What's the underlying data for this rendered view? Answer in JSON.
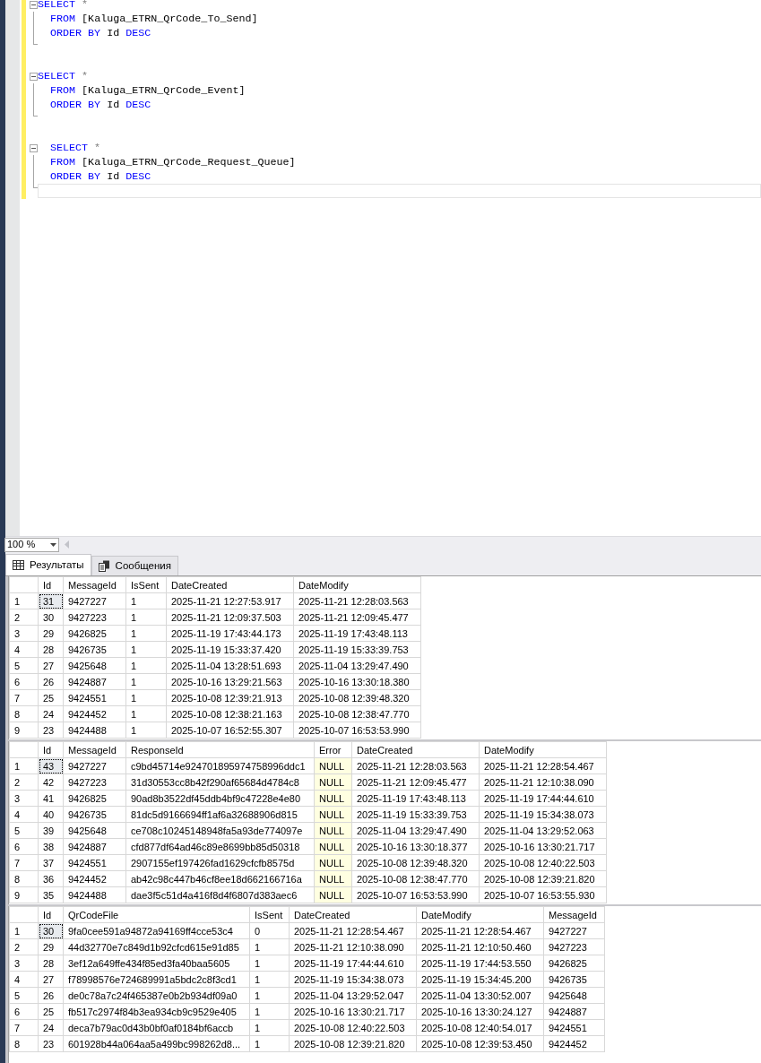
{
  "editor": {
    "blocks": [
      {
        "lines": [
          [
            {
              "kind": "keyword",
              "text": "SELECT"
            },
            {
              "kind": "operator",
              "text": " *"
            }
          ],
          [
            {
              "kind": "keyword",
              "text": "  FROM"
            },
            {
              "kind": "plain",
              "text": " [Kaluga_ETRN_QrCode_To_Send]"
            }
          ],
          [
            {
              "kind": "keyword",
              "text": "  ORDER BY"
            },
            {
              "kind": "plain",
              "text": " Id "
            },
            {
              "kind": "keyword",
              "text": "DESC"
            }
          ]
        ]
      },
      {
        "lines": [
          [
            {
              "kind": "keyword",
              "text": "SELECT"
            },
            {
              "kind": "operator",
              "text": " *"
            }
          ],
          [
            {
              "kind": "keyword",
              "text": "  FROM"
            },
            {
              "kind": "plain",
              "text": " [Kaluga_ETRN_QrCode_Event]"
            }
          ],
          [
            {
              "kind": "keyword",
              "text": "  ORDER BY"
            },
            {
              "kind": "plain",
              "text": " Id "
            },
            {
              "kind": "keyword",
              "text": "DESC"
            }
          ]
        ]
      },
      {
        "lines": [
          [
            {
              "kind": "keyword",
              "text": "  SELECT"
            },
            {
              "kind": "operator",
              "text": " *"
            }
          ],
          [
            {
              "kind": "keyword",
              "text": "  FROM"
            },
            {
              "kind": "plain",
              "text": " [Kaluga_ETRN_QrCode_Request_Queue]"
            }
          ],
          [
            {
              "kind": "keyword",
              "text": "  ORDER BY"
            },
            {
              "kind": "plain",
              "text": " Id "
            },
            {
              "kind": "keyword",
              "text": "DESC"
            }
          ]
        ]
      }
    ]
  },
  "zoom": "100 %",
  "tabs": [
    {
      "label": "Результаты",
      "kind": "grid",
      "selected": true
    },
    {
      "label": "Сообщения",
      "kind": "messages",
      "selected": false
    }
  ],
  "grids": [
    {
      "columns": [
        {
          "name": "Id",
          "kind": "text"
        },
        {
          "name": "MessageId",
          "kind": "text"
        },
        {
          "name": "IsSent",
          "kind": "text"
        },
        {
          "name": "DateCreated",
          "kind": "text"
        },
        {
          "name": "DateModify",
          "kind": "text"
        }
      ],
      "rows": [
        {
          "number": "1",
          "focused": true,
          "cells": [
            "31",
            "9427227",
            "1",
            "2025-11-21 12:27:53.917",
            "2025-11-21 12:28:03.563"
          ]
        },
        {
          "number": "2",
          "focused": false,
          "cells": [
            "30",
            "9427223",
            "1",
            "2025-11-21 12:09:37.503",
            "2025-11-21 12:09:45.477"
          ]
        },
        {
          "number": "3",
          "focused": false,
          "cells": [
            "29",
            "9426825",
            "1",
            "2025-11-19 17:43:44.173",
            "2025-11-19 17:43:48.113"
          ]
        },
        {
          "number": "4",
          "focused": false,
          "cells": [
            "28",
            "9426735",
            "1",
            "2025-11-19 15:33:37.420",
            "2025-11-19 15:33:39.753"
          ]
        },
        {
          "number": "5",
          "focused": false,
          "cells": [
            "27",
            "9425648",
            "1",
            "2025-11-04 13:28:51.693",
            "2025-11-04 13:29:47.490"
          ]
        },
        {
          "number": "6",
          "focused": false,
          "cells": [
            "26",
            "9424887",
            "1",
            "2025-10-16 13:29:21.563",
            "2025-10-16 13:30:18.380"
          ]
        },
        {
          "number": "7",
          "focused": false,
          "cells": [
            "25",
            "9424551",
            "1",
            "2025-10-08 12:39:21.913",
            "2025-10-08 12:39:48.320"
          ]
        },
        {
          "number": "8",
          "focused": false,
          "cells": [
            "24",
            "9424452",
            "1",
            "2025-10-08 12:38:21.163",
            "2025-10-08 12:38:47.770"
          ]
        },
        {
          "number": "9",
          "focused": false,
          "cells": [
            "23",
            "9424488",
            "1",
            "2025-10-07 16:52:55.307",
            "2025-10-07 16:53:53.990"
          ]
        }
      ]
    },
    {
      "columns": [
        {
          "name": "Id",
          "kind": "text"
        },
        {
          "name": "MessageId",
          "kind": "text"
        },
        {
          "name": "ResponseId",
          "kind": "text"
        },
        {
          "name": "Error",
          "kind": "null"
        },
        {
          "name": "DateCreated",
          "kind": "text"
        },
        {
          "name": "DateModify",
          "kind": "text"
        }
      ],
      "rows": [
        {
          "number": "1",
          "focused": true,
          "cells": [
            "43",
            "9427227",
            "c9bd45714e924701895974758996ddc1",
            "NULL",
            "2025-11-21 12:28:03.563",
            "2025-11-21 12:28:54.467"
          ]
        },
        {
          "number": "2",
          "focused": false,
          "cells": [
            "42",
            "9427223",
            "31d30553cc8b42f290af65684d4784c8",
            "NULL",
            "2025-11-21 12:09:45.477",
            "2025-11-21 12:10:38.090"
          ]
        },
        {
          "number": "3",
          "focused": false,
          "cells": [
            "41",
            "9426825",
            "90ad8b3522df45ddb4bf9c47228e4e80",
            "NULL",
            "2025-11-19 17:43:48.113",
            "2025-11-19 17:44:44.610"
          ]
        },
        {
          "number": "4",
          "focused": false,
          "cells": [
            "40",
            "9426735",
            "81dc5d9166694ff1af6a32688906d815",
            "NULL",
            "2025-11-19 15:33:39.753",
            "2025-11-19 15:34:38.073"
          ]
        },
        {
          "number": "5",
          "focused": false,
          "cells": [
            "39",
            "9425648",
            "ce708c10245148948fa5a93de774097e",
            "NULL",
            "2025-11-04 13:29:47.490",
            "2025-11-04 13:29:52.063"
          ]
        },
        {
          "number": "6",
          "focused": false,
          "cells": [
            "38",
            "9424887",
            "cfd877df64ad46c89e8699bb85d50318",
            "NULL",
            "2025-10-16 13:30:18.377",
            "2025-10-16 13:30:21.717"
          ]
        },
        {
          "number": "7",
          "focused": false,
          "cells": [
            "37",
            "9424551",
            "2907155ef197426fad1629cfcfb8575d",
            "NULL",
            "2025-10-08 12:39:48.320",
            "2025-10-08 12:40:22.503"
          ]
        },
        {
          "number": "8",
          "focused": false,
          "cells": [
            "36",
            "9424452",
            "ab42c98c447b46cf8ee18d662166716a",
            "NULL",
            "2025-10-08 12:38:47.770",
            "2025-10-08 12:39:21.820"
          ]
        },
        {
          "number": "9",
          "focused": false,
          "cells": [
            "35",
            "9424488",
            "dae3f5c51d4a416f8d4f6807d383aec6",
            "NULL",
            "2025-10-07 16:53:53.990",
            "2025-10-07 16:53:55.930"
          ]
        }
      ]
    },
    {
      "columns": [
        {
          "name": "Id",
          "kind": "text"
        },
        {
          "name": "QrCodeFile",
          "kind": "text"
        },
        {
          "name": "IsSent",
          "kind": "text"
        },
        {
          "name": "DateCreated",
          "kind": "text"
        },
        {
          "name": "DateModify",
          "kind": "text"
        },
        {
          "name": "MessageId",
          "kind": "text"
        }
      ],
      "rows": [
        {
          "number": "1",
          "focused": true,
          "cells": [
            "30",
            "9fa0cee591a94872a94169ff4cce53c4",
            "0",
            "2025-11-21 12:28:54.467",
            "2025-11-21 12:28:54.467",
            "9427227"
          ]
        },
        {
          "number": "2",
          "focused": false,
          "cells": [
            "29",
            "44d32770e7c849d1b92cfcd615e91d85",
            "1",
            "2025-11-21 12:10:38.090",
            "2025-11-21 12:10:50.460",
            "9427223"
          ]
        },
        {
          "number": "3",
          "focused": false,
          "cells": [
            "28",
            "3ef12a649ffe434f85ed3fa40baa5605",
            "1",
            "2025-11-19 17:44:44.610",
            "2025-11-19 17:44:53.550",
            "9426825"
          ]
        },
        {
          "number": "4",
          "focused": false,
          "cells": [
            "27",
            "f78998576e724689991a5bdc2c8f3cd1",
            "1",
            "2025-11-19 15:34:38.073",
            "2025-11-19 15:34:45.200",
            "9426735"
          ]
        },
        {
          "number": "5",
          "focused": false,
          "cells": [
            "26",
            "de0c78a7c24f465387e0b2b934df09a0",
            "1",
            "2025-11-04 13:29:52.047",
            "2025-11-04 13:30:52.007",
            "9425648"
          ]
        },
        {
          "number": "6",
          "focused": false,
          "cells": [
            "25",
            "fb517c2974f84b3ea934cb9c9529e405",
            "1",
            "2025-10-16 13:30:21.717",
            "2025-10-16 13:30:24.127",
            "9424887"
          ]
        },
        {
          "number": "7",
          "focused": false,
          "cells": [
            "24",
            "deca7b79ac0d43b0bf0af0184bf6accb",
            "1",
            "2025-10-08 12:40:22.503",
            "2025-10-08 12:40:54.017",
            "9424551"
          ]
        },
        {
          "number": "8",
          "focused": false,
          "cells": [
            "23",
            "601928b44a064aa5a499bc998262d8...",
            "1",
            "2025-10-08 12:39:21.820",
            "2025-10-08 12:39:53.450",
            "9424452"
          ]
        }
      ]
    }
  ]
}
